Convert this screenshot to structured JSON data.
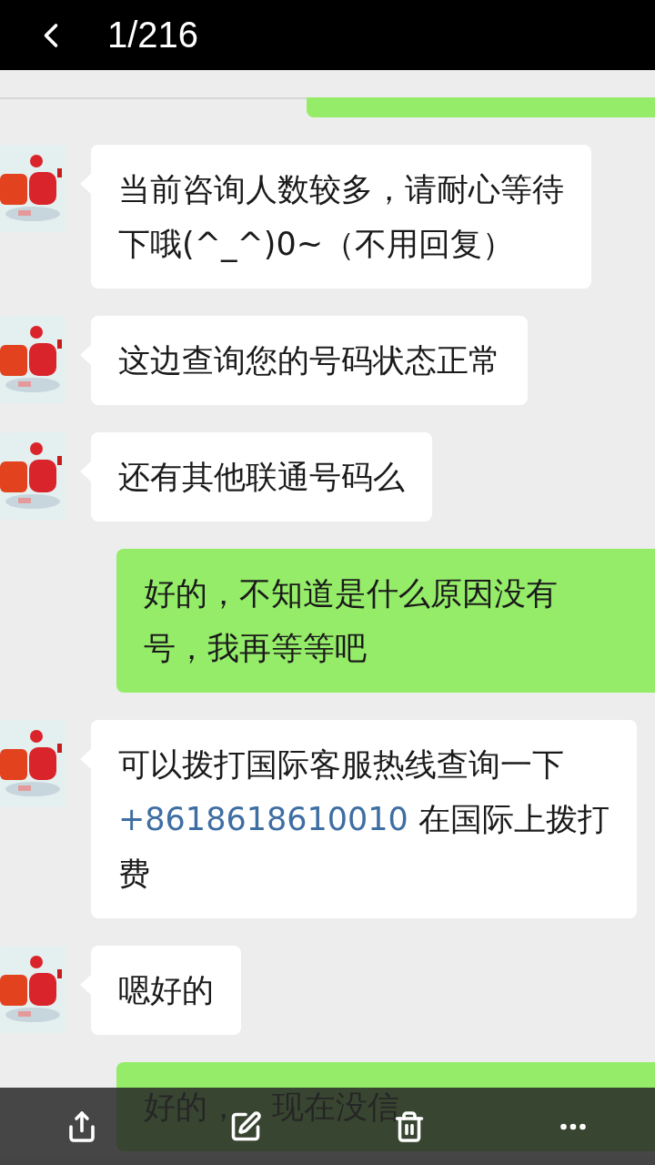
{
  "header": {
    "counter": "1/216"
  },
  "messages": [
    {
      "kind": "sent"
    },
    {
      "kind": "received",
      "lines": [
        [
          {
            "text": "当前咨询人数较多，请耐心等待",
            "link": false
          }
        ],
        [
          {
            "text": "下哦(^_^)0~（不用回复）",
            "link": false
          }
        ]
      ]
    },
    {
      "kind": "received",
      "lines": [
        [
          {
            "text": "这边查询您的号码状态正常",
            "link": false
          }
        ]
      ]
    },
    {
      "kind": "received",
      "lines": [
        [
          {
            "text": "还有其他联通号码么",
            "link": false
          }
        ]
      ]
    },
    {
      "kind": "sent",
      "lines": [
        [
          {
            "text": "好的，不知道是什么原因没有",
            "link": false
          }
        ],
        [
          {
            "text": "号，我再等等吧",
            "link": false
          }
        ]
      ]
    },
    {
      "kind": "received",
      "lines": [
        [
          {
            "text": "可以拨打国际客服热线查询一下",
            "link": false
          }
        ],
        [
          {
            "text": "+8618618610010",
            "link": true
          },
          {
            "text": " 在国际上拨打",
            "link": false
          }
        ],
        [
          {
            "text": "费",
            "link": false
          }
        ]
      ]
    },
    {
      "kind": "received",
      "lines": [
        [
          {
            "text": "嗯好的",
            "link": false
          }
        ]
      ]
    },
    {
      "kind": "sent",
      "lines": [
        [
          {
            "text": "好的，",
            "link": false
          },
          {
            "text": "现在没信",
            "link": false
          }
        ]
      ]
    }
  ],
  "toolbar": [
    {
      "kind": "share"
    },
    {
      "kind": "edit"
    },
    {
      "kind": "delete"
    },
    {
      "kind": "more"
    }
  ]
}
